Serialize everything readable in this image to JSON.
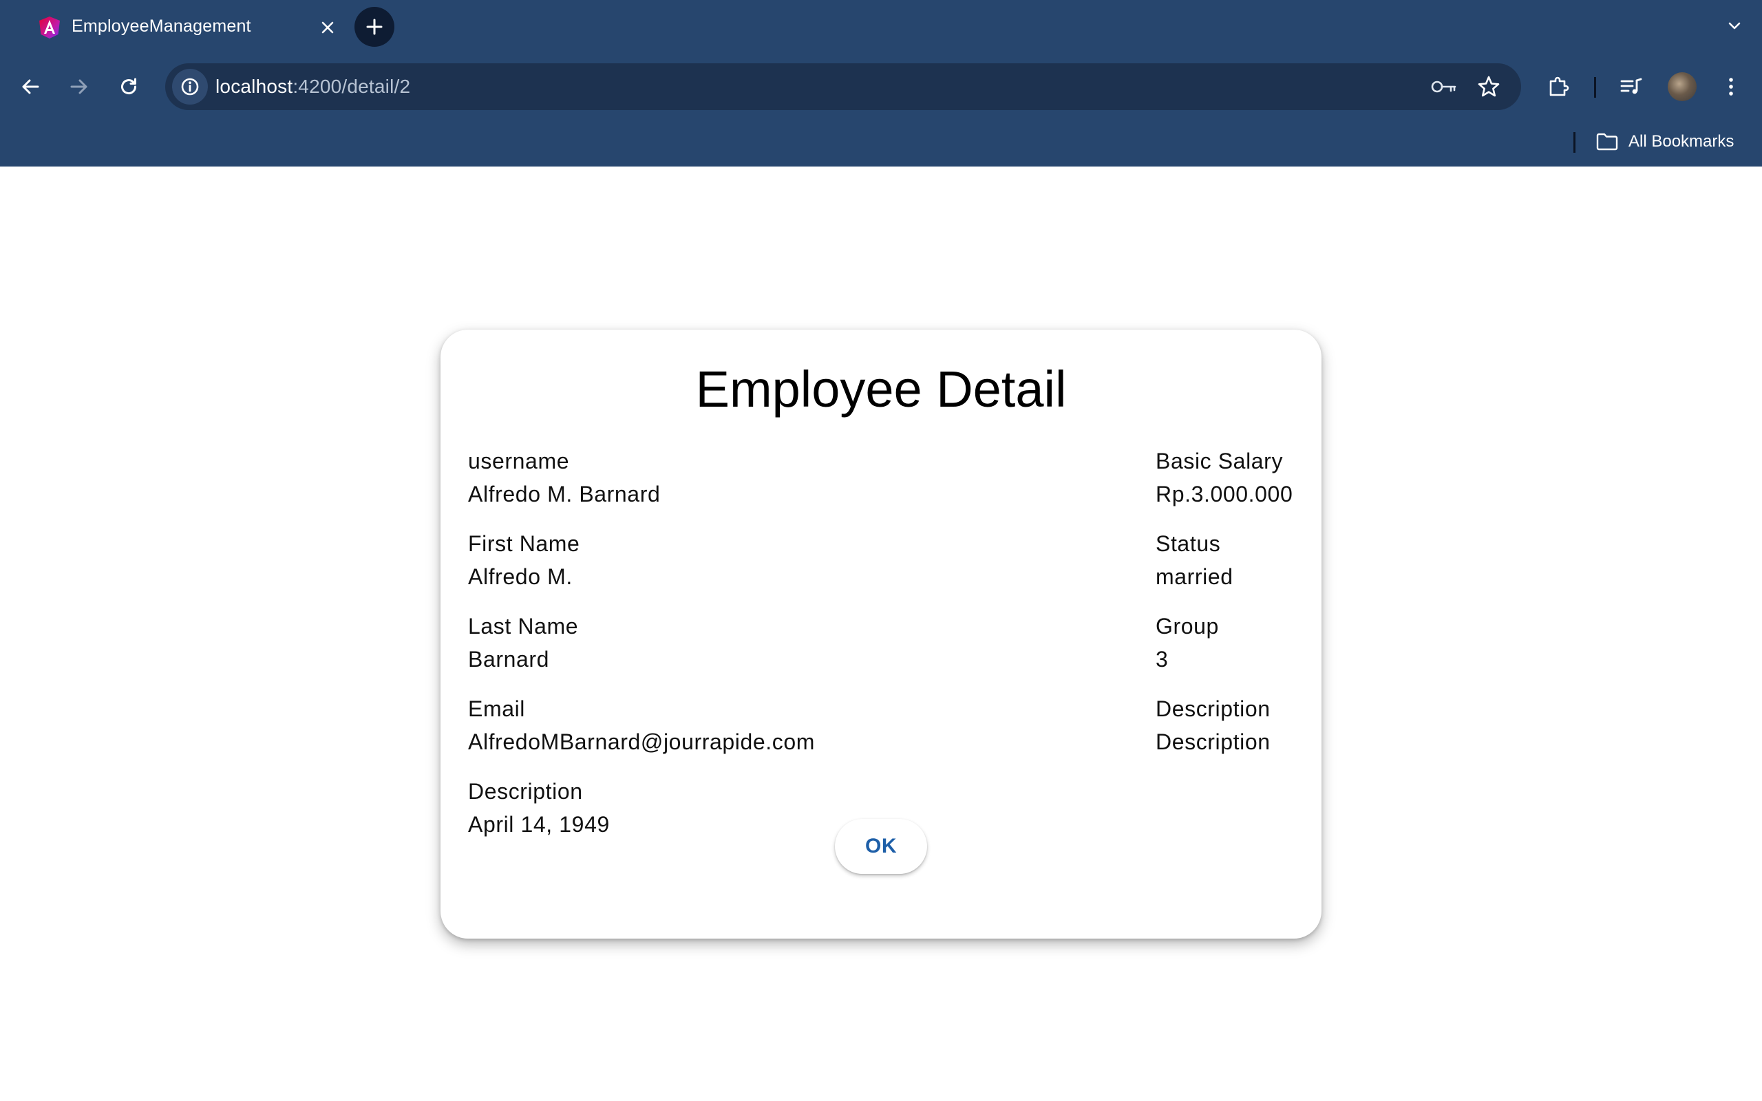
{
  "browser": {
    "tab": {
      "title": "EmployeeManagement"
    },
    "address_bar": {
      "host": "localhost",
      "path": ":4200/detail/2"
    },
    "bookmarks_bar": {
      "all_bookmarks_label": "All Bookmarks"
    },
    "icons": {
      "favicon": "angular-logo-icon",
      "close": "close-icon",
      "new_tab": "plus-icon",
      "tab_list": "chevron-down-icon",
      "back": "back-arrow-icon",
      "forward": "forward-arrow-icon",
      "reload": "reload-icon",
      "site_info": "info-icon",
      "passwords": "key-icon",
      "bookmark": "star-icon",
      "extensions": "puzzle-icon",
      "media": "media-queue-icon",
      "menu": "kebab-menu-icon",
      "folder": "folder-icon"
    }
  },
  "dialog": {
    "title": "Employee Detail",
    "left_fields": [
      {
        "label": "username",
        "value": "Alfredo M. Barnard"
      },
      {
        "label": "First Name",
        "value": "Alfredo M."
      },
      {
        "label": "Last Name",
        "value": "Barnard"
      },
      {
        "label": "Email",
        "value": "AlfredoMBarnard@jourrapide.com"
      },
      {
        "label": "Description",
        "value": "April 14, 1949"
      }
    ],
    "right_fields": [
      {
        "label": "Basic Salary",
        "value": "Rp.3.000.000"
      },
      {
        "label": "Status",
        "value": "married"
      },
      {
        "label": "Group",
        "value": "3"
      },
      {
        "label": "Description",
        "value": "Description"
      }
    ],
    "ok_label": "OK"
  },
  "colors": {
    "chrome_bg": "#27466e",
    "omnibox_bg": "#1d3250",
    "ok_text": "#1e5fa8"
  }
}
